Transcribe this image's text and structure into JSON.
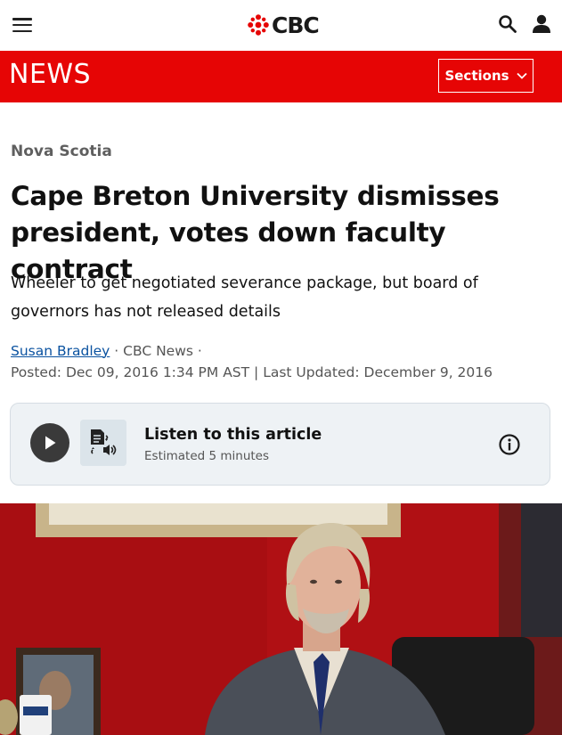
{
  "header": {
    "logo_text": "CBC",
    "menu_icon": "hamburger-menu-icon",
    "search_icon": "search-icon",
    "account_icon": "user-icon"
  },
  "newsbar": {
    "label": "NEWS",
    "sections_label": "Sections",
    "background": "#e60505"
  },
  "article": {
    "category": "Nova Scotia",
    "headline": "Cape Breton University dismisses president, votes down faculty contract",
    "deck": "Wheeler to get negotiated severance package, but board of governors has not released details",
    "author": "Susan Bradley",
    "byline_rest": " · CBC News ·",
    "dateline": "Posted: Dec 09, 2016 1:34 PM AST | Last Updated: December 9, 2016"
  },
  "audio": {
    "title": "Listen to this article",
    "subtitle": "Estimated 5 minutes",
    "play_icon": "play-icon",
    "tts_icon": "text-to-speech-icon",
    "info_icon": "info-icon"
  },
  "photo": {
    "subject": "man-in-suit-seated-at-desk-red-wall"
  }
}
